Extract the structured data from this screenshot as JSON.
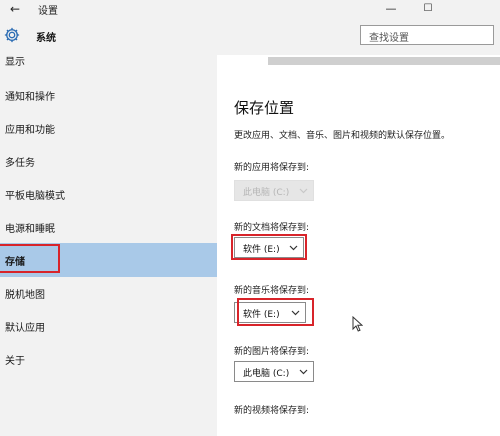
{
  "window": {
    "title": "设置",
    "back_icon": "arrow-left-icon",
    "minimize_glyph": "—",
    "maximize_glyph": "☐"
  },
  "header": {
    "icon": "gear-icon",
    "title": "系统",
    "search_placeholder": "查找设置"
  },
  "sidebar": {
    "items": [
      {
        "label": "显示"
      },
      {
        "label": "通知和操作"
      },
      {
        "label": "应用和功能"
      },
      {
        "label": "多任务"
      },
      {
        "label": "平板电脑模式"
      },
      {
        "label": "电源和睡眠"
      },
      {
        "label": "存储",
        "selected": true
      },
      {
        "label": "脱机地图"
      },
      {
        "label": "默认应用"
      },
      {
        "label": "关于"
      }
    ]
  },
  "main": {
    "title": "保存位置",
    "description": "更改应用、文档、音乐、图片和视频的默认保存位置。",
    "fields": [
      {
        "label": "新的应用将保存到:",
        "value": "此电脑 (C:)",
        "disabled": true
      },
      {
        "label": "新的文档将保存到:",
        "value": "软件 (E:)"
      },
      {
        "label": "新的音乐将保存到:",
        "value": "软件 (E:)"
      },
      {
        "label": "新的图片将保存到:",
        "value": "此电脑 (C:)"
      },
      {
        "label": "新的视频将保存到:"
      }
    ]
  },
  "colors": {
    "accent_selected": "#a9c9e8",
    "highlight_red": "#d8242a",
    "sidebar_bg": "#f2f2f2"
  }
}
